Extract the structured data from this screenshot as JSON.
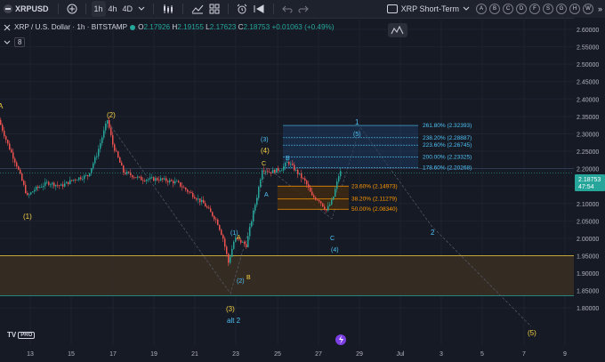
{
  "toolbar": {
    "symbol": "XRPUSD",
    "intervals": [
      "1h",
      "4h",
      "4D"
    ],
    "active_interval": "1h",
    "layout_name": "XRP Short-Term",
    "layout_letters": [
      "A",
      "B",
      "C",
      "D",
      "F",
      "S",
      "G",
      "H",
      "W"
    ]
  },
  "legend": {
    "title": "XRP / U.S. Dollar · 1h · BITSTAMP",
    "o_label": "O",
    "o": "2.17926",
    "h_label": "H",
    "h": "2.19155",
    "l_label": "L",
    "l": "2.17623",
    "c_label": "C",
    "c": "2.18753",
    "change": "+0.01063 (+0.49%)"
  },
  "indicator_count": "8",
  "logo": {
    "text": "TV",
    "badge": "PRO"
  },
  "price_axis": [
    "2.60000",
    "2.55000",
    "2.50000",
    "2.45000",
    "2.40000",
    "2.35000",
    "2.30000",
    "2.25000",
    "2.20000",
    "2.15000",
    "2.10000",
    "2.05000",
    "2.00000",
    "1.95000",
    "1.90000",
    "1.85000",
    "1.80000"
  ],
  "price_axis_values": [
    2.6,
    2.55,
    2.5,
    2.45,
    2.4,
    2.35,
    2.3,
    2.25,
    2.2,
    2.15,
    2.1,
    2.05,
    2.0,
    1.95,
    1.9,
    1.85,
    1.8
  ],
  "current_price": {
    "price": "2.18753",
    "countdown": "47:54",
    "value": 2.18753
  },
  "time_axis": [
    "13",
    "15",
    "17",
    "19",
    "21",
    "23",
    "25",
    "27",
    "29",
    "Jul",
    "3",
    "5",
    "7",
    "9"
  ],
  "fib_levels": [
    {
      "label": "261.80% (2.32393)",
      "value": 2.32393
    },
    {
      "label": "238.20% (2.28887)",
      "value": 2.28887
    },
    {
      "label": "223.60% (2.26745)",
      "value": 2.26745
    },
    {
      "label": "200.00% (2.23325)",
      "value": 2.23325
    },
    {
      "label": "178.60% (2.20268)",
      "value": 2.20268
    },
    {
      "label": "23.60% (2.14973)",
      "value": 2.14973
    },
    {
      "label": "38.20% (2.11279)",
      "value": 2.11279
    },
    {
      "label": "50.00% (2.08340)",
      "value": 2.0834
    }
  ],
  "wave_labels": {
    "w1": "(1)",
    "w2": "(2)",
    "w3": "(3)",
    "w4": "(4)",
    "w5": "(5)",
    "A": "A",
    "B": "B",
    "C": "C",
    "sub1": "(1)",
    "sub2": "(2)",
    "sub3": "(3)",
    "sub4": "(4)",
    "sub5": "(5)",
    "alt2": "alt 2",
    "big1": "1",
    "big2": "2",
    "w5target": "(5)"
  },
  "colors": {
    "background": "#161a25",
    "up": "#26a69a",
    "down": "#ef5350",
    "fib_upper": "#2962ff",
    "fib_lower": "#ff9800",
    "support_zone": "#3a2f23",
    "wave_yellow": "#f5d142",
    "wave_cyan": "#4fc3f7"
  }
}
